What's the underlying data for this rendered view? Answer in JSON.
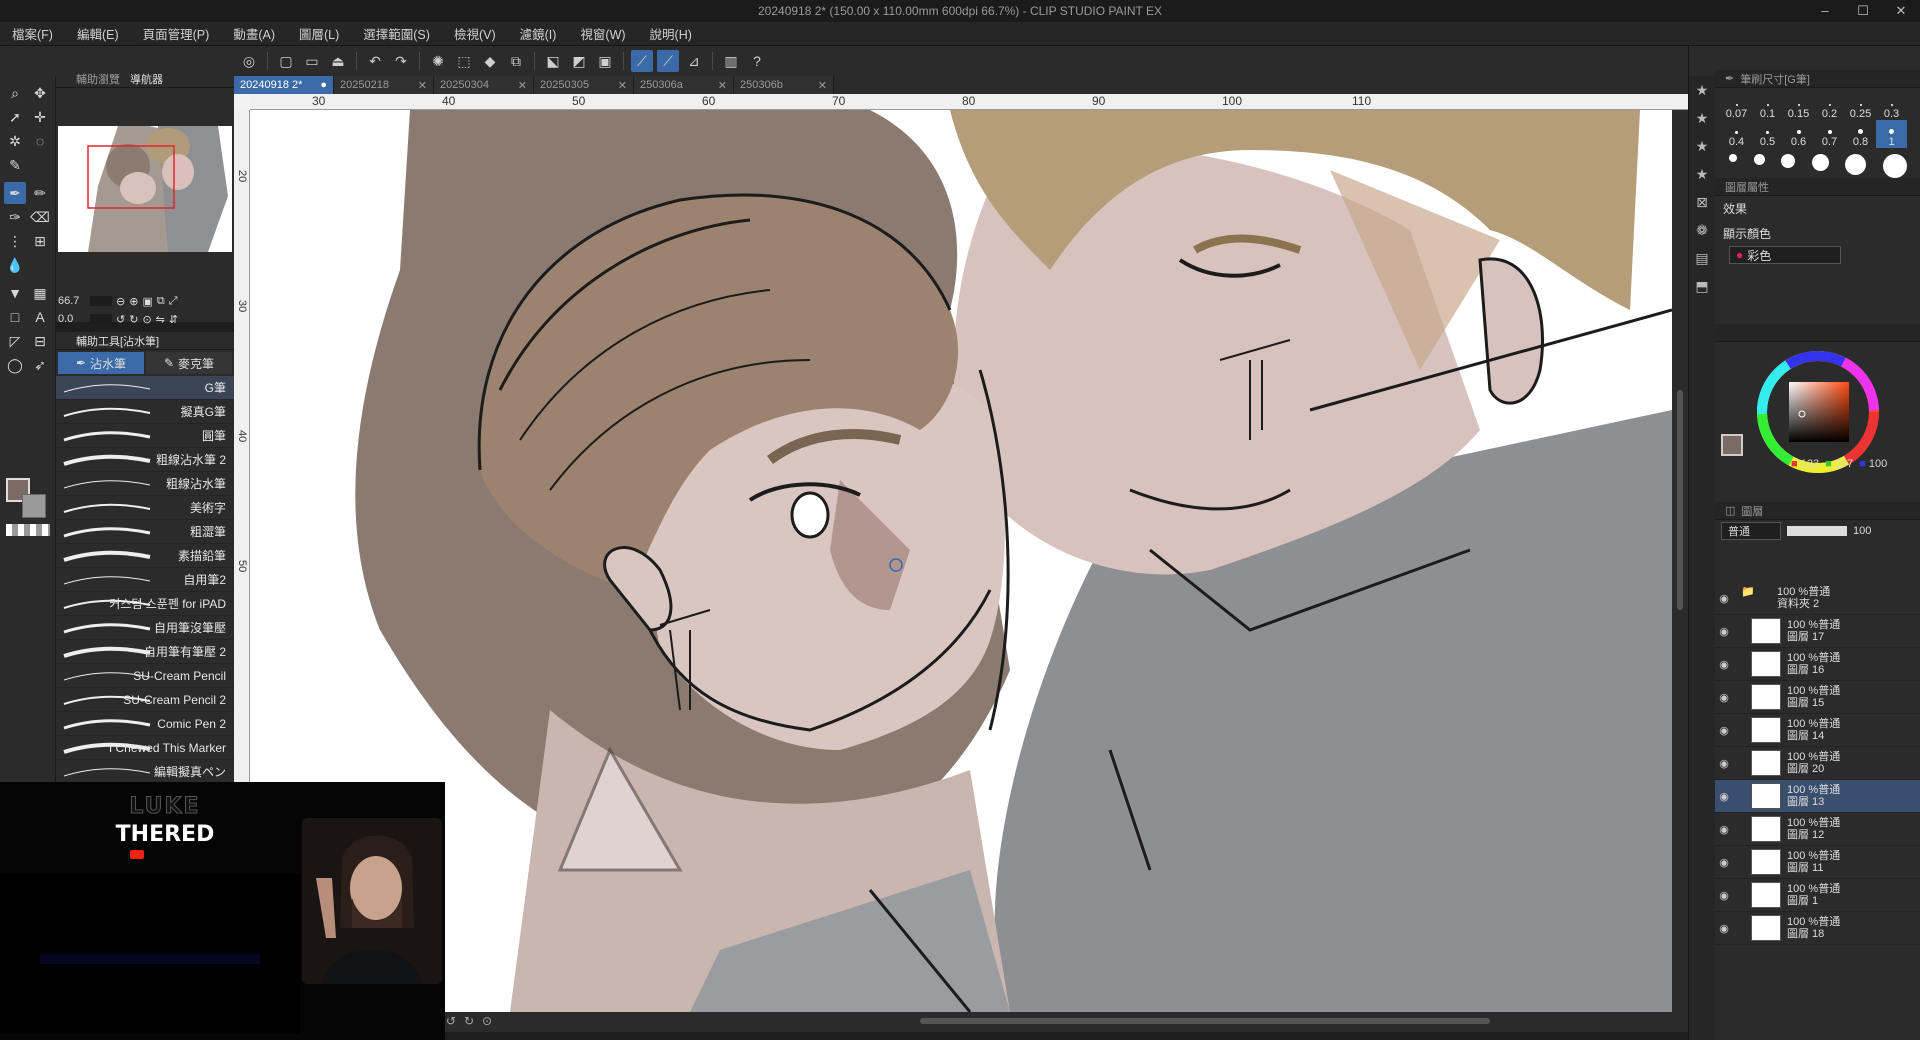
{
  "window": {
    "title": "20240918 2* (150.00 x 110.00mm 600dpi 66.7%) - CLIP STUDIO PAINT EX",
    "controls": [
      "–",
      "☐",
      "✕"
    ]
  },
  "menu": [
    "檔案(F)",
    "編輯(E)",
    "頁面管理(P)",
    "動畫(A)",
    "圖層(L)",
    "選擇範圍(S)",
    "檢視(V)",
    "濾鏡(I)",
    "視窗(W)",
    "說明(H)"
  ],
  "navigator": {
    "tabs": [
      "輔助瀏覽",
      "導航器"
    ],
    "zoom": "66.7",
    "rotation": "0.0"
  },
  "subtool": {
    "header": "輔助工具[沾水筆]",
    "tabs": [
      "沾水筆",
      "麥克筆"
    ],
    "brushes": [
      "G筆",
      "擬真G筆",
      "圓筆",
      "粗線沾水筆 2",
      "粗線沾水筆",
      "美術字",
      "粗澀筆",
      "素描鉛筆",
      "自用筆2",
      "커스텀 스푼펜 for iPAD",
      "自用筆沒筆壓",
      "自用筆有筆壓 2",
      "SU-Cream Pencil",
      "SU-Cream Pencil 2",
      "Comic Pen 2",
      "I Chewed This Marker",
      "編輯擬真ペン"
    ]
  },
  "doc_tabs": [
    {
      "label": "20240918 2*",
      "active": true,
      "mark": "●"
    },
    {
      "label": "20250218",
      "active": false,
      "mark": "✕"
    },
    {
      "label": "20250304",
      "active": false,
      "mark": "✕"
    },
    {
      "label": "20250305",
      "active": false,
      "mark": "✕"
    },
    {
      "label": "250306a",
      "active": false,
      "mark": "✕"
    },
    {
      "label": "250306b",
      "active": false,
      "mark": "✕"
    }
  ],
  "ruler": {
    "h": [
      "30",
      "40",
      "50",
      "60",
      "70",
      "80",
      "90",
      "100",
      "110"
    ],
    "v": [
      "20",
      "30",
      "40",
      "50"
    ]
  },
  "brush_size": {
    "header": "筆刷尺寸[G筆]",
    "sizes": [
      "0.07",
      "0.1",
      "0.15",
      "0.2",
      "0.25",
      "0.3",
      "0.4",
      "0.5",
      "0.6",
      "0.7",
      "0.8",
      "1"
    ],
    "selected": "1"
  },
  "layer_property": {
    "header": "圖層屬性",
    "effect_label": "效果",
    "display_color_label": "顯示顏色",
    "display_color_value": "彩色"
  },
  "color": {
    "r": "123",
    "g": "107",
    "b": "100",
    "current_hex": "#7b6b64"
  },
  "layers_panel": {
    "header": "圖層",
    "blend": "普通",
    "opacity": "100",
    "items": [
      {
        "mode": "100 %普通",
        "name": "資料夾 2",
        "kind": "folder",
        "active": false
      },
      {
        "mode": "100 %普通",
        "name": "圖層 17",
        "kind": "layer",
        "active": false
      },
      {
        "mode": "100 %普通",
        "name": "圖層 16",
        "kind": "layer",
        "active": false
      },
      {
        "mode": "100 %普通",
        "name": "圖層 15",
        "kind": "layer",
        "active": false
      },
      {
        "mode": "100 %普通",
        "name": "圖層 14",
        "kind": "layer",
        "active": false
      },
      {
        "mode": "100 %普通",
        "name": "圖層 20",
        "kind": "layer",
        "active": false
      },
      {
        "mode": "100 %普通",
        "name": "圖層 13",
        "kind": "layer",
        "active": true
      },
      {
        "mode": "100 %普通",
        "name": "圖層 12",
        "kind": "layer",
        "active": false
      },
      {
        "mode": "100 %普通",
        "name": "圖層 11",
        "kind": "layer",
        "active": false
      },
      {
        "mode": "100 %普通",
        "name": "圖層 1",
        "kind": "layer",
        "active": false
      },
      {
        "mode": "100 %普通",
        "name": "圖層 18",
        "kind": "layer",
        "active": false
      }
    ]
  },
  "overlay": {
    "logo_line1": "LUKE",
    "logo_line2": "THERED"
  }
}
